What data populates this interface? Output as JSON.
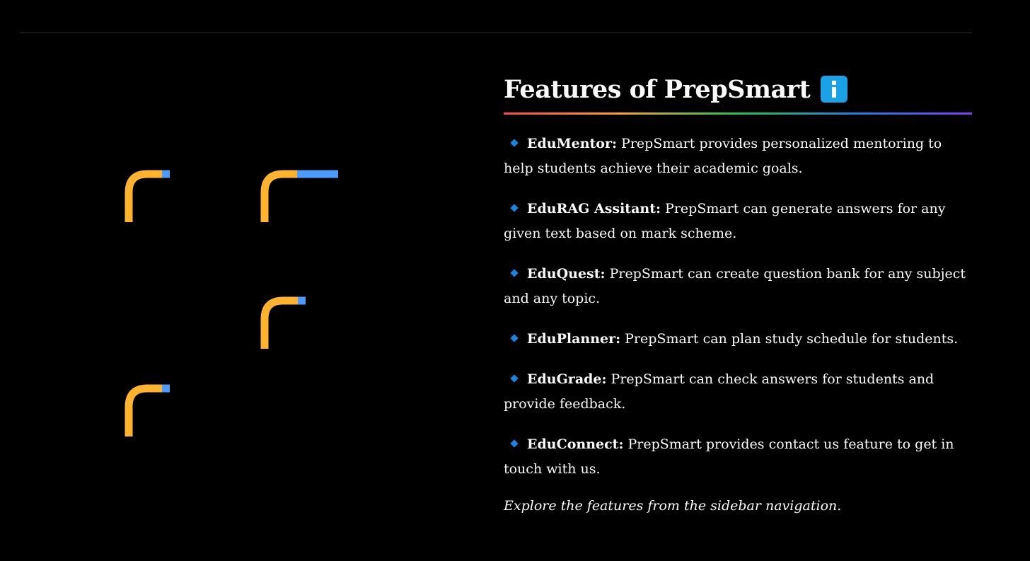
{
  "header": {
    "title": "Features of PrepSmart",
    "title_icon": "info-icon"
  },
  "colors": {
    "background": "#000000",
    "text": "#fafafa",
    "accent_blue": "#1c83e1",
    "info_icon_bg": "#1aa1e6",
    "pipe_orange": "#ffb32e",
    "pipe_blue": "#4c9cff"
  },
  "decorations": {
    "icon": "pipe-elbow-icon"
  },
  "features": [
    {
      "name": "EduMentor:",
      "description": " PrepSmart provides personalized mentoring to help students achieve their academic goals."
    },
    {
      "name": "EduRAG Assitant:",
      "description": " PrepSmart can generate answers for any given text based on mark scheme."
    },
    {
      "name": "EduQuest:",
      "description": " PrepSmart can create question bank for any subject and any topic."
    },
    {
      "name": "EduPlanner:",
      "description": " PrepSmart can plan study schedule for students."
    },
    {
      "name": "EduGrade:",
      "description": " PrepSmart can check answers for students and provide feedback."
    },
    {
      "name": "EduConnect:",
      "description": " PrepSmart provides contact us feature to get in touch with us."
    }
  ],
  "footer_note": "Explore the features from the sidebar navigation."
}
